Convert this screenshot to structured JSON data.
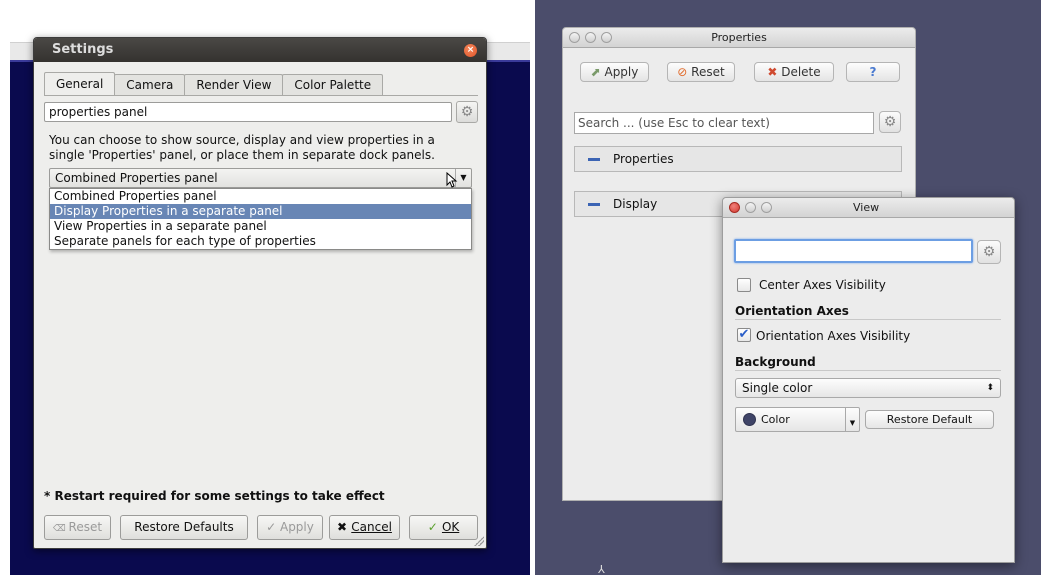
{
  "settings": {
    "title": "Settings",
    "tabs": [
      "General",
      "Camera",
      "Render View",
      "Color Palette"
    ],
    "search_value": "properties panel",
    "description": "You can choose to show source, display and view properties in a single 'Properties' panel, or place them in separate dock panels.",
    "combo_selected": "Combined Properties panel",
    "options": [
      "Combined Properties panel",
      "Display Properties in a separate panel",
      "View Properties in a separate panel",
      "Separate panels for each type of properties"
    ],
    "note": "* Restart required for some settings to take effect",
    "buttons": {
      "reset": "Reset",
      "restore_defaults": "Restore Defaults",
      "apply": "Apply",
      "cancel": "Cancel",
      "ok": "OK"
    }
  },
  "properties_window": {
    "title": "Properties",
    "toolbar": {
      "apply": "Apply",
      "reset": "Reset",
      "delete": "Delete",
      "help": "?"
    },
    "search_placeholder": "Search ... (use Esc to clear text)",
    "sections": [
      "Properties",
      "Display"
    ]
  },
  "view_window": {
    "title": "View",
    "center_axes_label": "Center Axes Visibility",
    "orientation_axes_heading": "Orientation Axes",
    "orientation_axes_label": "Orientation Axes Visibility",
    "background_heading": "Background",
    "background_select": "Single color",
    "color_button": "Color",
    "restore_default": "Restore Default",
    "background_color": "#3f4467"
  },
  "colors": {
    "accent": "#6886b5",
    "desktop": "#4b4d6b",
    "app_bg": "#0a0a4e"
  }
}
